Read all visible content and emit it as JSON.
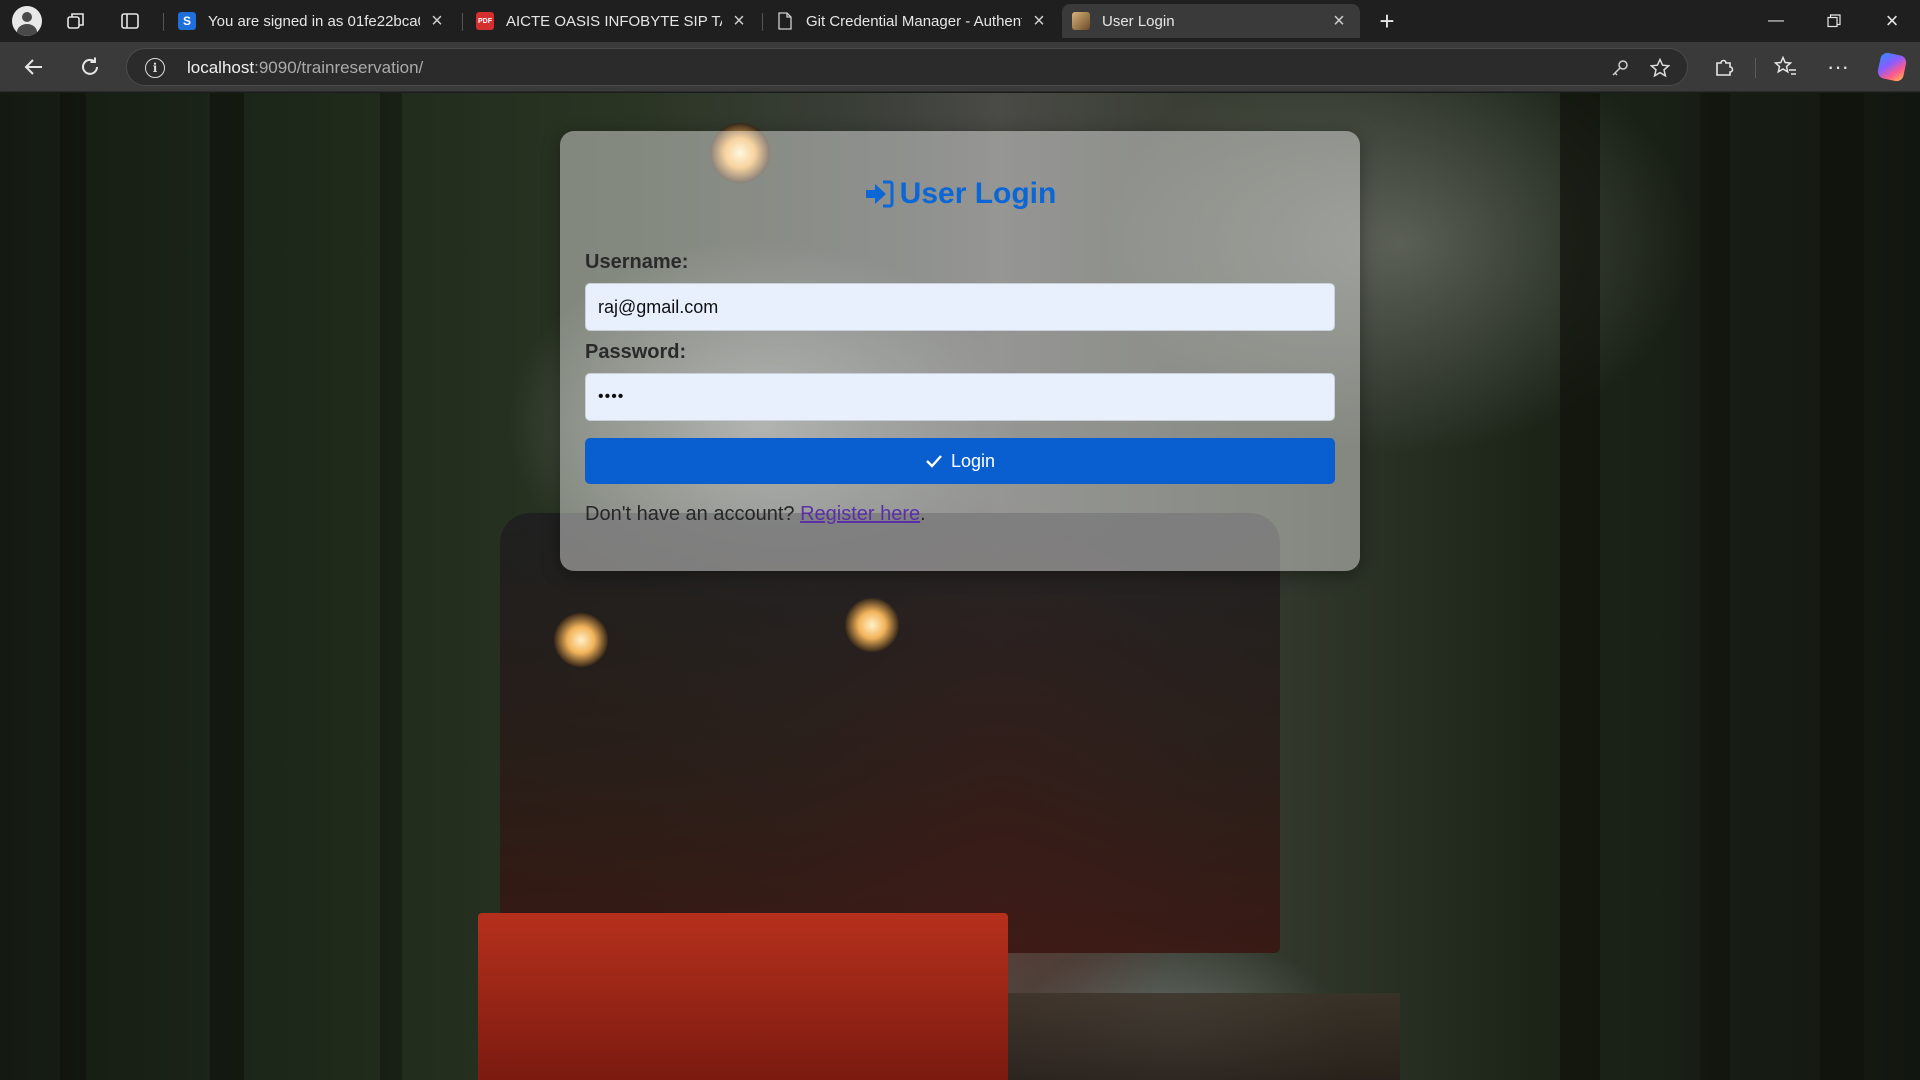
{
  "browser": {
    "tabs": [
      {
        "title": "You are signed in as 01fe22bca00",
        "favicon": "S",
        "favicon_color": "#1e6fd9",
        "active": false
      },
      {
        "title": "AICTE OASIS INFOBYTE SIP TASK L",
        "favicon": "PDF",
        "favicon_color": "#d32f2f",
        "active": false
      },
      {
        "title": "Git Credential Manager - Authent",
        "favicon": "doc",
        "favicon_color": "#3a3a3a",
        "active": false
      },
      {
        "title": "User Login",
        "favicon": "img",
        "favicon_color": "#c9a06a",
        "active": true
      }
    ],
    "url_host": "localhost",
    "url_rest": ":9090/trainreservation/"
  },
  "login": {
    "title": "User Login",
    "username_label": "Username:",
    "username_value": "raj@gmail.com",
    "password_label": "Password:",
    "password_mask": "••••",
    "button_label": "Login",
    "register_prefix": "Don't have an account?",
    "register_link": "Register here",
    "register_suffix": "."
  },
  "colors": {
    "accent": "#0a5fd0",
    "title": "#0b66d6",
    "link": "#5c2ea8"
  }
}
